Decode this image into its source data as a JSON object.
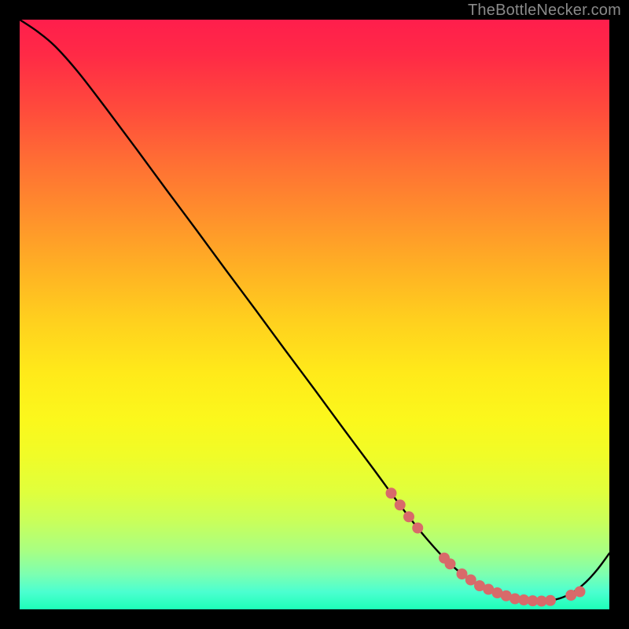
{
  "watermark": "TheBottleNecker.com",
  "colors": {
    "page_bg": "#000000",
    "curve_stroke": "#000000",
    "marker_fill": "#d86a6a",
    "marker_stroke": "#d86a6a",
    "watermark": "#8a8a8a"
  },
  "chart_data": {
    "type": "line",
    "title": "",
    "xlabel": "",
    "ylabel": "",
    "grid": false,
    "legend": false,
    "xlim": [
      0,
      100
    ],
    "ylim": [
      0,
      100
    ],
    "x": [
      0,
      3,
      6,
      10,
      15,
      20,
      25,
      30,
      35,
      40,
      45,
      50,
      55,
      60,
      63,
      66,
      69,
      72,
      75,
      78,
      80,
      82,
      84,
      86,
      88,
      90,
      92,
      94,
      96,
      98,
      100
    ],
    "y": [
      100,
      98,
      95.5,
      91,
      84.5,
      77.8,
      71,
      64.3,
      57.5,
      50.8,
      44,
      37.3,
      30.5,
      23.8,
      19.7,
      15.7,
      12,
      8.7,
      6,
      4,
      3,
      2.3,
      1.8,
      1.5,
      1.4,
      1.5,
      2,
      3,
      4.6,
      6.8,
      9.5
    ],
    "markers": {
      "x": [
        63,
        64.5,
        66,
        67.5,
        72,
        73,
        75,
        76.5,
        78,
        79.5,
        81,
        82.5,
        84,
        85.5,
        87,
        88.5,
        90,
        93.5,
        95
      ],
      "y": [
        19.7,
        17.7,
        15.7,
        13.8,
        8.7,
        7.7,
        6.0,
        5.0,
        4.0,
        3.4,
        2.8,
        2.3,
        1.8,
        1.6,
        1.45,
        1.4,
        1.5,
        2.4,
        3.0
      ]
    },
    "annotations": []
  }
}
